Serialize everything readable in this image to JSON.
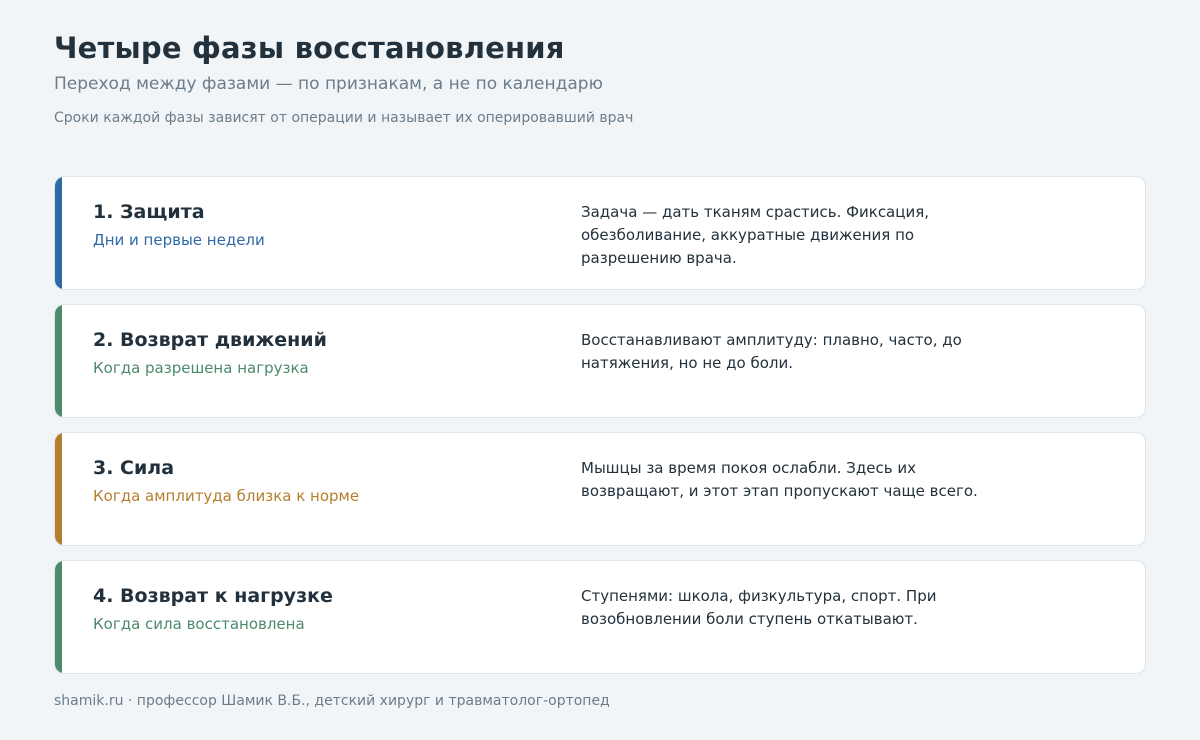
{
  "header": {
    "title": "Четыре фазы восстановления",
    "subtitle": "Переход между фазами — по признакам, а не по календарю",
    "note": "Сроки каждой фазы зависят от операции и называет их оперировавший врач"
  },
  "colors": {
    "protection": "#2f6aa8",
    "movement": "#4d8a6b",
    "strength": "#b47f2d",
    "load": "#4d8a6b"
  },
  "phases": [
    {
      "title": "1. Защита",
      "when": "Дни и первые недели",
      "description": "Задача — дать тканям срастись. Фиксация, обезболивание, аккуратные движения по разрешению врача."
    },
    {
      "title": "2. Возврат движений",
      "when": "Когда разрешена нагрузка",
      "description": "Восстанавливают амплитуду: плавно, часто, до натяжения, но не до боли."
    },
    {
      "title": "3. Сила",
      "when": "Когда амплитуда близка к норме",
      "description": "Мышцы за время покоя ослабли. Здесь их возвращают, и этот этап пропускают чаще всего."
    },
    {
      "title": "4. Возврат к нагрузке",
      "when": "Когда сила восстановлена",
      "description": "Ступенями: школа, физкультура, спорт. При возобновлении боли ступень откатывают."
    }
  ],
  "footer": {
    "text": "shamik.ru · профессор Шамик В.Б., детский хирург и травматолог-ортопед"
  }
}
